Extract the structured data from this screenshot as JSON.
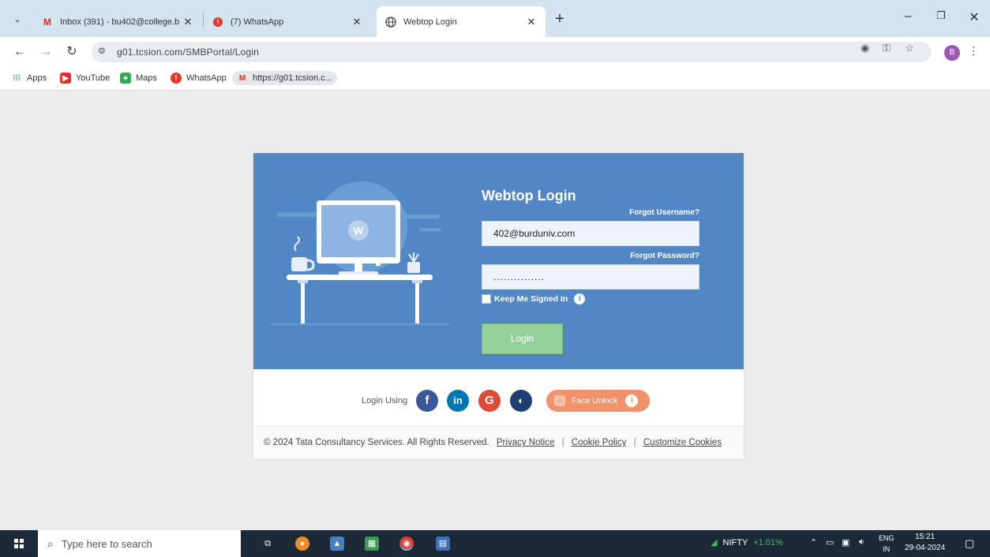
{
  "browser": {
    "tabs": [
      {
        "title": "Inbox (391) - bu402@college.b",
        "icon": "gmail-icon"
      },
      {
        "title": "(7) WhatsApp",
        "icon": "whatsapp-icon"
      },
      {
        "title": "Webtop Login",
        "icon": "globe-icon"
      }
    ],
    "url": "g01.tcsion.com/SMBPortal/Login",
    "profile_initial": "B",
    "bookmarks": [
      {
        "label": "Apps"
      },
      {
        "label": "YouTube"
      },
      {
        "label": "Maps"
      },
      {
        "label": "WhatsApp"
      },
      {
        "label": "https://g01.tcsion.c..."
      }
    ]
  },
  "login": {
    "title": "Webtop Login",
    "forgot_username": "Forgot Username?",
    "username_value": "402@burduniv.com",
    "forgot_password": "Forgot Password?",
    "password_value": "...............",
    "keep_signed_in": "Keep Me Signed In",
    "login_button": "Login",
    "login_using": "Login Using",
    "face_unlock": "Face Unlock",
    "illustration_logo": "W"
  },
  "footer": {
    "copyright": "© 2024 Tata Consultancy Services. All Rights Reserved.",
    "privacy": "Privacy Notice",
    "cookie": "Cookie Policy",
    "customize": "Customize Cookies"
  },
  "taskbar": {
    "search_placeholder": "Type here to search",
    "nifty_label": "NIFTY",
    "nifty_change": "+1.01%",
    "lang_top": "ENG",
    "lang_bottom": "IN",
    "time": "15:21",
    "date": "29-04-2024"
  },
  "colors": {
    "card_blue": "#5287c5",
    "login_green": "#93d19a",
    "face_unlock_orange": "#f0926a",
    "facebook": "#3b5998",
    "linkedin": "#0077b5",
    "google": "#dd4b39"
  }
}
